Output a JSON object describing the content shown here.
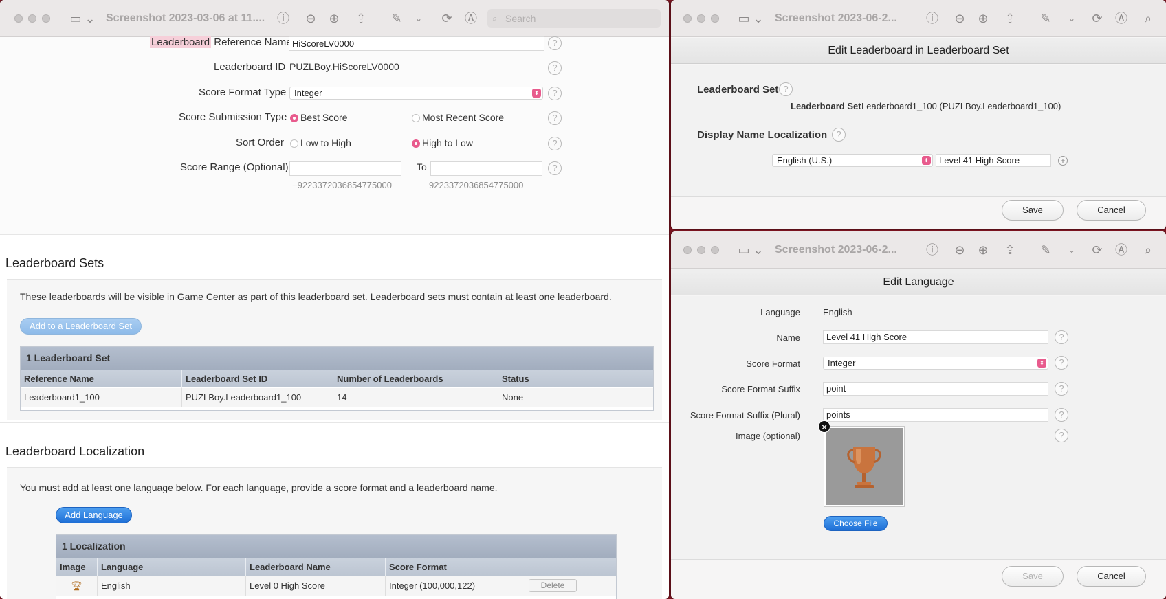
{
  "left_window": {
    "title": "Screenshot 2023-03-06 at 11....",
    "search_placeholder": "Search",
    "form": {
      "ref_name_highlight": "Leaderboard",
      "ref_name_label": " Reference Name",
      "ref_name_value": "HiScoreLV0000",
      "id_label": "Leaderboard ID",
      "id_value": "PUZLBoy.HiScoreLV0000",
      "score_format_label": "Score Format Type",
      "score_format_value": "Integer",
      "submission_label": "Score Submission Type",
      "submission_opt1": "Best Score",
      "submission_opt2": "Most Recent Score",
      "sort_label": "Sort Order",
      "sort_opt1": "Low to High",
      "sort_opt2": "High to Low",
      "range_label": "Score Range (Optional)",
      "range_to": "To",
      "range_min_hint": "−9223372036854775000",
      "range_max_hint": "9223372036854775000"
    },
    "sets": {
      "title": "Leaderboard Sets",
      "description": "These leaderboards will be visible in Game Center as part of this leaderboard set. Leaderboard sets must contain at least one leaderboard.",
      "add_button": "Add to a Leaderboard Set",
      "table_caption": "1 Leaderboard Set",
      "columns": [
        "Reference Name",
        "Leaderboard Set ID",
        "Number of Leaderboards",
        "Status"
      ],
      "rows": [
        [
          "Leaderboard1_100",
          "PUZLBoy.Leaderboard1_100",
          "14",
          "None"
        ]
      ]
    },
    "localization": {
      "title": "Leaderboard Localization",
      "description": "You must add at least one language below. For each language, provide a score format and a leaderboard name.",
      "add_button": "Add Language",
      "table_caption": "1 Localization",
      "columns": [
        "Image",
        "Language",
        "Leaderboard Name",
        "Score Format"
      ],
      "rows": [
        {
          "image_icon": "trophy-icon",
          "language": "English",
          "name": "Level 0 High Score",
          "format": "Integer (100,000,122)",
          "action": "Delete"
        }
      ]
    }
  },
  "right_top_window": {
    "title": "Screenshot 2023-06-2...",
    "sheet_title": "Edit Leaderboard in Leaderboard Set",
    "set_heading": "Leaderboard Set",
    "set_label": "Leaderboard Set",
    "set_value": "Leaderboard1_100 (PUZLBoy.Leaderboard1_100)",
    "display_heading": "Display Name Localization",
    "language_select": "English (U.S.)",
    "display_name_value": "Level 41 High Score",
    "save": "Save",
    "cancel": "Cancel"
  },
  "right_bottom_window": {
    "title": "Screenshot 2023-06-2...",
    "sheet_title": "Edit Language",
    "language_label": "Language",
    "language_value": "English",
    "name_label": "Name",
    "name_value": "Level 41 High Score",
    "format_label": "Score Format",
    "format_value": "Integer",
    "suffix_label": "Score Format Suffix",
    "suffix_value": "point",
    "suffix_plural_label": "Score Format Suffix (Plural)",
    "suffix_plural_value": "points",
    "image_label": "Image (optional)",
    "choose_file": "Choose File",
    "save": "Save",
    "cancel": "Cancel"
  },
  "colors": {
    "accent_pink": "#e85b8d",
    "button_blue": "#1e6fd6",
    "desktop": "#7a1420"
  }
}
